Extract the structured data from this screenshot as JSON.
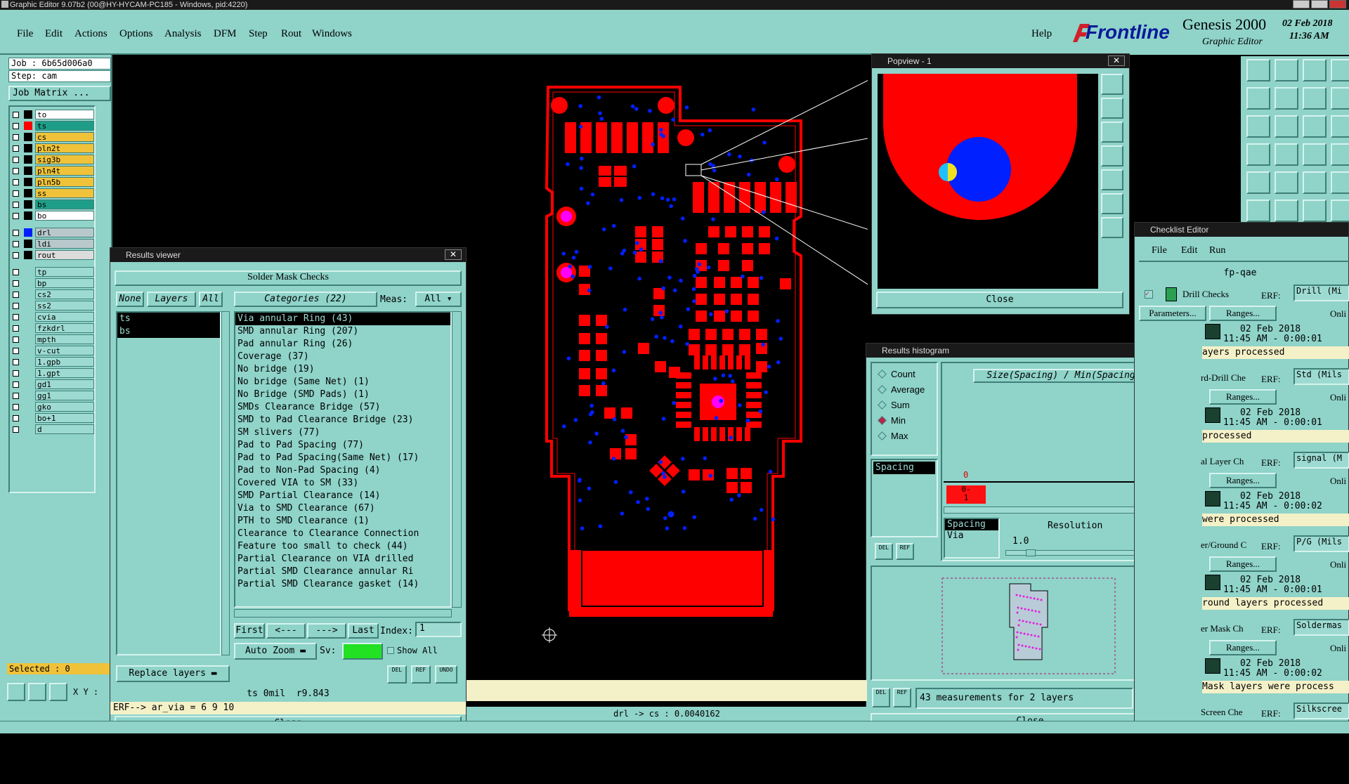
{
  "window_title": "Graphic Editor 9.07b2 (00@HY-HYCAM-PC185 - Windows, pid:4220)",
  "menu": [
    "File",
    "Edit",
    "Actions",
    "Options",
    "Analysis",
    "DFM",
    "Step",
    "Rout",
    "Windows"
  ],
  "help_label": "Help",
  "brand": {
    "logo": "Frontline",
    "product": "Genesis 2000",
    "subtitle": "Graphic Editor",
    "date": "02 Feb 2018",
    "time": "11:36 AM"
  },
  "job": {
    "job_label": "Job : 6b65d006a0",
    "step_label": "Step: cam",
    "matrix_button": "Job Matrix ..."
  },
  "layers_group1": [
    {
      "name": "to",
      "color": "#ffffff",
      "swatch": "#000000"
    },
    {
      "name": "ts",
      "color": "#1e9e88",
      "swatch": "#ff0000"
    },
    {
      "name": "cs",
      "color": "#f0c23a",
      "swatch": "#000000"
    },
    {
      "name": "pln2t",
      "color": "#f0c23a",
      "swatch": "#000000"
    },
    {
      "name": "sig3b",
      "color": "#f0c23a",
      "swatch": "#000000"
    },
    {
      "name": "pln4t",
      "color": "#f0c23a",
      "swatch": "#000000"
    },
    {
      "name": "pln5b",
      "color": "#f0c23a",
      "swatch": "#000000"
    },
    {
      "name": "ss",
      "color": "#f0c23a",
      "swatch": "#000000"
    },
    {
      "name": "bs",
      "color": "#1e9e88",
      "swatch": "#000000"
    },
    {
      "name": "bo",
      "color": "#ffffff",
      "swatch": "#000000"
    }
  ],
  "layers_group2": [
    {
      "name": "drl",
      "color": "#b8c8cc",
      "swatch": "#0020ff"
    },
    {
      "name": "ldi",
      "color": "#b8c8cc",
      "swatch": "#000000"
    },
    {
      "name": "rout",
      "color": "#dcdcdc",
      "swatch": "#000000"
    }
  ],
  "layers_group3": [
    {
      "name": "tp",
      "color": "#9ddbd2"
    },
    {
      "name": "bp",
      "color": "#9ddbd2"
    },
    {
      "name": "cs2",
      "color": "#9ddbd2"
    },
    {
      "name": "ss2",
      "color": "#9ddbd2"
    },
    {
      "name": "cvia",
      "color": "#9ddbd2"
    },
    {
      "name": "fzkdrl",
      "color": "#9ddbd2"
    },
    {
      "name": "mpth",
      "color": "#9ddbd2"
    },
    {
      "name": "v-cut",
      "color": "#9ddbd2"
    },
    {
      "name": "1.gpb",
      "color": "#9ddbd2"
    },
    {
      "name": "1.gpt",
      "color": "#9ddbd2"
    },
    {
      "name": "gd1",
      "color": "#9ddbd2"
    },
    {
      "name": "gg1",
      "color": "#9ddbd2"
    },
    {
      "name": "gko",
      "color": "#9ddbd2"
    },
    {
      "name": "bo+1",
      "color": "#9ddbd2"
    },
    {
      "name": "d",
      "color": "#9ddbd2"
    }
  ],
  "selected_label": "Selected : 0",
  "xy_label": "X Y :",
  "results_viewer": {
    "title": "Results viewer",
    "header": "Solder Mask Checks",
    "none_btn": "None",
    "layers_btn": "Layers",
    "all_btn": "All",
    "categories_label": "Categories (22)",
    "meas_label": "Meas:",
    "meas_value": "All",
    "layers": [
      "ts",
      "bs"
    ],
    "categories": [
      "Via annular Ring (43)",
      "SMD annular Ring (207)",
      "Pad annular Ring (26)",
      "Coverage (37)",
      "No bridge (19)",
      "No bridge (Same Net) (1)",
      "No Bridge (SMD Pads) (1)",
      "SMDs Clearance Bridge (57)",
      "SMD to Pad Clearance Bridge (23)",
      "SM slivers (77)",
      "Pad to Pad Spacing (77)",
      "Pad to Pad Spacing(Same Net) (17)",
      "Pad to Non-Pad Spacing (4)",
      "Covered VIA to SM (33)",
      "SMD Partial Clearance (14)",
      "Via to SMD Clearance (67)",
      "PTH to SMD Clearance (1)",
      "Clearance to Clearance Connection",
      "Feature too small to check (44)",
      "Partial Clearance on VIA drilled",
      "Partial SMD Clearance annular Ri",
      "Partial SMD Clearance gasket (14)"
    ],
    "first_btn": "First",
    "prev_btn": "<---",
    "next_btn": "--->",
    "last_btn": "Last",
    "index_label": "Index:",
    "index_value": "1",
    "autozoom_label": "Auto Zoom",
    "sv_label": "Sv:",
    "show_all_label": "Show All",
    "replace_layers_label": "Replace layers",
    "del_label": "DEL",
    "ref_label": "REF",
    "undo_label": "UNDO",
    "status1": "ts 0mil  r9.843",
    "status2": "ERF--> ar_via = 6 9 10",
    "close_label": "Close"
  },
  "popview": {
    "title": "Popview - 1",
    "close_label": "Close"
  },
  "histogram": {
    "title": "Results histogram",
    "options": [
      {
        "label": "Count",
        "on": false
      },
      {
        "label": "Average",
        "on": false
      },
      {
        "label": "Sum",
        "on": false
      },
      {
        "label": "Min",
        "on": true
      },
      {
        "label": "Max",
        "on": false
      }
    ],
    "chart_title": "Size(Spacing) / Min(Spacing)",
    "list_items": [
      "Spacing"
    ],
    "bar_count": "0",
    "bar_label": "0-\n1",
    "meas_list": [
      "Spacing",
      "Via"
    ],
    "resolution_label": "Resolution",
    "resolution_value": "1.0",
    "del_label": "DEL",
    "ref_label": "REF",
    "summary": "43 measurements for 2 layers",
    "close_label": "Close"
  },
  "checklist": {
    "title": "Checklist Editor",
    "menu": [
      "File",
      "Edit",
      "Run"
    ],
    "name": "fp-qae",
    "rows": [
      {
        "check": "Drill Checks",
        "erf": "Drill (Mi",
        "date": "02 Feb 2018",
        "time": "11:45 AM - 0:00:01",
        "status": "ayers processed"
      },
      {
        "check": "rd-Drill Che",
        "erf": "Std (Mils",
        "date": "02 Feb 2018",
        "time": "11:45 AM - 0:00:01",
        "status": "processed"
      },
      {
        "check": "al Layer Ch",
        "erf": "signal (M",
        "date": "02 Feb 2018",
        "time": "11:45 AM - 0:00:02",
        "status": "were processed"
      },
      {
        "check": "er/Ground C",
        "erf": "P/G (Mils",
        "date": "02 Feb 2018",
        "time": "11:45 AM - 0:00:01",
        "status": "round layers processed"
      },
      {
        "check": "er Mask Ch",
        "erf": "Soldermas",
        "date": "02 Feb 2018",
        "time": "11:45 AM - 0:00:02",
        "status": "Mask layers were process"
      },
      {
        "check": "Screen Che",
        "erf": "Silkscree",
        "date": "",
        "time": "",
        "status": ""
      }
    ],
    "erf_label": "ERF:",
    "params_label": "Parameters...",
    "ranges_label": "Ranges...",
    "online_label": "Onli"
  },
  "bottom_status": "drl -> cs : 0.0040162",
  "colors": {
    "panel": "#8fd3c9",
    "copper": "#ff0000",
    "drill": "#0020ff",
    "highlight": "#ff00ff"
  }
}
